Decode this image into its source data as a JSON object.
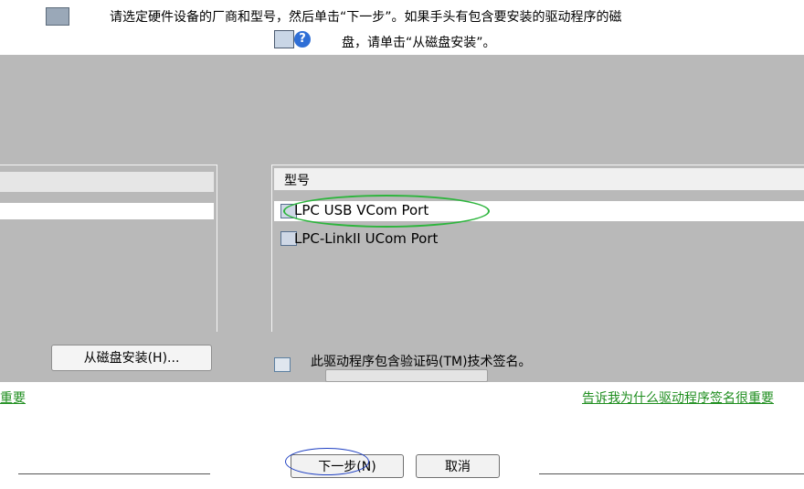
{
  "header": {
    "instruction_line1": "请选定硬件设备的厂商和型号，然后单击“下一步”。如果手头有包含要安装的驱动程序的磁",
    "instruction_line2": "盘，请单击“从磁盘安装”。",
    "help_glyph": "?"
  },
  "model_list": {
    "header": "型号",
    "items": [
      {
        "label": "LPC USB VCom Port",
        "selected": true,
        "icon": "device-icon"
      },
      {
        "label": "LPC-LinkII UCom Port",
        "selected": false,
        "icon": "device-icon"
      }
    ]
  },
  "buttons": {
    "have_disk": "从磁盘安装(H)...",
    "next": "下一步(N)",
    "cancel": "取消"
  },
  "signature": {
    "text": "此驱动程序包含验证码(TM)技术签名。",
    "link": "告诉我为什么驱动程序签名很重要",
    "left_link_fragment": "重要"
  },
  "colors": {
    "dialog_gray": "#b9b9b9",
    "link_green": "#1f8e1f",
    "highlight_green": "#2db53d",
    "annotation_blue": "#1e3fc2"
  }
}
